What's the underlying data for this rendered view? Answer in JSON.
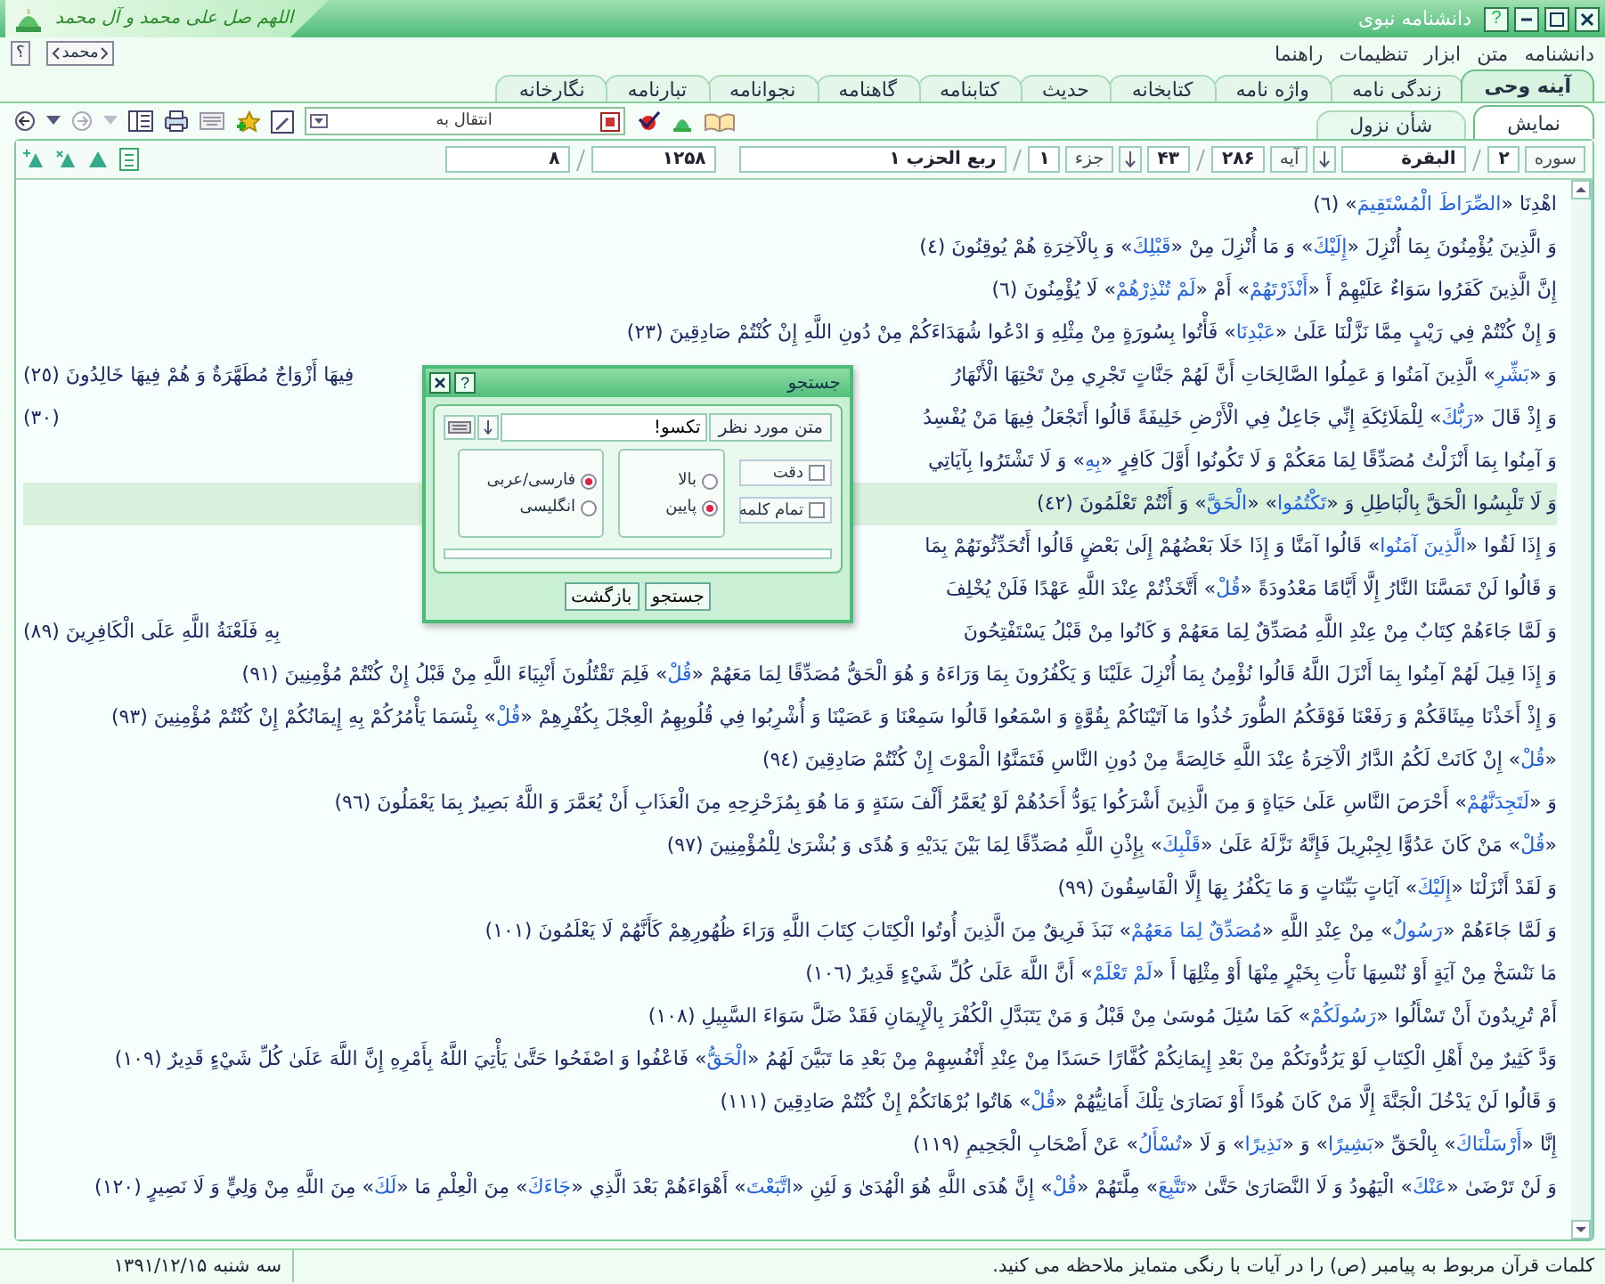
{
  "window": {
    "title": "دانشنامه نبوی",
    "banner": "اللهم صل علی محمد و آل محمد",
    "help_glyph": "?"
  },
  "menu": {
    "items": [
      "دانشنامه",
      "متن",
      "ابزار",
      "تنظیمات",
      "راهنما"
    ],
    "help_button": "؟",
    "name_button": "محمد"
  },
  "tabs": [
    {
      "label": "آینه وحی",
      "selected": true
    },
    {
      "label": "زندگی نامه",
      "selected": false
    },
    {
      "label": "واژه نامه",
      "selected": false
    },
    {
      "label": "کتابخانه",
      "selected": false
    },
    {
      "label": "حدیث",
      "selected": false
    },
    {
      "label": "کتابنامه",
      "selected": false
    },
    {
      "label": "گاهنامه",
      "selected": false
    },
    {
      "label": "نجوانامه",
      "selected": false
    },
    {
      "label": "تبارنامه",
      "selected": false
    },
    {
      "label": "نگارخانه",
      "selected": false
    }
  ],
  "toolbar": {
    "goto_select": "انتقال به"
  },
  "subtabs": [
    {
      "label": "نمایش",
      "selected": true
    },
    {
      "label": "شأن نزول",
      "selected": false
    }
  ],
  "navigation": {
    "sura_label": "سوره",
    "sura_number": "۲",
    "sura_name": "البقرة",
    "aya_label": "آیه",
    "aya_total": "۲۸۶",
    "aya_number": "۴۳",
    "juz_label": "جزء",
    "juz_number": "۱",
    "hizb": "ربع الحزب ۱",
    "page_total": "۱۲۵۸",
    "page": "۸"
  },
  "verses": [
    {
      "text": "اهْدِنَا «**الصِّرَاطَ الْمُسْتَقِيمَ**» (٦)",
      "selected": false
    },
    {
      "text": "وَ الَّذِينَ يُؤْمِنُونَ بِمَا أُنْزِلَ «**إِلَيْكَ**» وَ مَا أُنْزِلَ مِنْ «**قَبْلِكَ**» وَ بِالْآخِرَةِ هُمْ يُوقِنُونَ (٤)",
      "selected": false
    },
    {
      "text": "إِنَّ الَّذِينَ كَفَرُوا سَوَاءٌ عَلَيْهِمْ أَ «**أَنْذَرْتَهُمْ**» أَمْ «**لَمْ تُنْذِرْهُمْ**» لَا يُؤْمِنُونَ (٦)",
      "selected": false
    },
    {
      "text": "وَ إِنْ كُنْتُمْ فِي رَيْبٍ مِمَّا نَزَّلْنَا عَلَىٰ «**عَبْدِنَا**» فَأْتُوا بِسُورَةٍ مِنْ مِثْلِهِ وَ ادْعُوا شُهَدَاءَكُمْ مِنْ دُونِ اللَّهِ إِنْ كُنْتُمْ صَادِقِينَ (٢٣)",
      "selected": false
    },
    {
      "text": "وَ «**بَشِّرِ**» الَّذِينَ آمَنُوا وَ عَمِلُوا الصَّالِحَاتِ أَنَّ لَهُمْ جَنَّاتٍ تَجْرِي مِنْ تَحْتِهَا الْأَنْهَارُ",
      "left": "فِيهَا أَزْوَاجٌ مُطَهَّرَةٌ وَ هُمْ فِيهَا خَالِدُونَ (٢٥)",
      "selected": false
    },
    {
      "text": "وَ إِذْ قَالَ «**رَبُّكَ**» لِلْمَلَائِكَةِ إِنِّي جَاعِلٌ فِي الْأَرْضِ خَلِيفَةً قَالُوا أَتَجْعَلُ فِيهَا مَنْ يُفْسِدُ",
      "left": "(٣٠)",
      "selected": false
    },
    {
      "text": "وَ آمِنُوا بِمَا أَنْزَلْتُ مُصَدِّقًا لِمَا مَعَكُمْ وَ لَا تَكُونُوا أَوَّلَ كَافِرٍ «**بِهِ**» وَ لَا تَشْتَرُوا بِآيَاتِي",
      "selected": false
    },
    {
      "text": "وَ لَا تَلْبِسُوا الْحَقَّ بِالْبَاطِلِ وَ «**تَكْتُمُوا**» «**الْحَقَّ**» وَ أَنْتُمْ تَعْلَمُونَ (٤٢)",
      "selected": true
    },
    {
      "text": "وَ إِذَا لَقُوا «**الَّذِينَ آمَنُوا**» قَالُوا آمَنَّا وَ إِذَا خَلَا بَعْضُهُمْ إِلَىٰ بَعْضٍ قَالُوا أَتُحَدِّثُونَهُمْ بِمَا",
      "selected": false
    },
    {
      "text": "وَ قَالُوا لَنْ تَمَسَّنَا النَّارُ إِلَّا أَيَّامًا مَعْدُودَةً «**قُلْ**» أَتَّخَذْتُمْ عِنْدَ اللَّهِ عَهْدًا فَلَنْ يُخْلِفَ",
      "selected": false
    },
    {
      "text": "وَ لَمَّا جَاءَهُمْ كِتَابٌ مِنْ عِنْدِ اللَّهِ مُصَدِّقٌ لِمَا مَعَهُمْ وَ كَانُوا مِنْ قَبْلُ يَسْتَفْتِحُونَ",
      "left": "بِهِ فَلَعْنَةُ اللَّهِ عَلَى الْكَافِرِينَ (٨٩)",
      "selected": false
    },
    {
      "text": "وَ إِذَا قِيلَ لَهُمْ آمِنُوا بِمَا أَنْزَلَ اللَّهُ قَالُوا نُؤْمِنُ بِمَا أُنْزِلَ عَلَيْنَا وَ يَكْفُرُونَ بِمَا وَرَاءَهُ وَ هُوَ الْحَقُّ مُصَدِّقًا لِمَا مَعَهُمْ «**قُلْ**» فَلِمَ تَقْتُلُونَ أَنْبِيَاءَ اللَّهِ مِنْ قَبْلُ إِنْ كُنْتُمْ مُؤْمِنِينَ (٩١)",
      "selected": false
    },
    {
      "text": "وَ إِذْ أَخَذْنَا مِيثَاقَكُمْ وَ رَفَعْنَا فَوْقَكُمُ الطُّورَ خُذُوا مَا آتَيْنَاكُمْ بِقُوَّةٍ وَ اسْمَعُوا قَالُوا سَمِعْنَا وَ عَصَيْنَا وَ أُشْرِبُوا فِي قُلُوبِهِمُ الْعِجْلَ بِكُفْرِهِمْ «**قُلْ**» بِئْسَمَا يَأْمُرُكُمْ بِهِ إِيمَانُكُمْ إِنْ كُنْتُمْ مُؤْمِنِينَ (٩٣)",
      "selected": false
    },
    {
      "text": "«**قُلْ**» إِنْ كَانَتْ لَكُمُ الدَّارُ الْآخِرَةُ عِنْدَ اللَّهِ خَالِصَةً مِنْ دُونِ النَّاسِ فَتَمَنَّوُا الْمَوْتَ إِنْ كُنْتُمْ صَادِقِينَ (٩٤)",
      "selected": false
    },
    {
      "text": "وَ «**لَتَجِدَنَّهُمْ**» أَحْرَصَ النَّاسِ عَلَىٰ حَيَاةٍ وَ مِنَ الَّذِينَ أَشْرَكُوا يَوَدُّ أَحَدُهُمْ لَوْ يُعَمَّرُ أَلْفَ سَنَةٍ وَ مَا هُوَ بِمُزَحْزِحِهِ مِنَ الْعَذَابِ أَنْ يُعَمَّرَ وَ اللَّهُ بَصِيرٌ بِمَا يَعْمَلُونَ (٩٦)",
      "selected": false
    },
    {
      "text": "«**قُلْ**» مَنْ كَانَ عَدُوًّا لِجِبْرِيلَ فَإِنَّهُ نَزَّلَهُ عَلَىٰ «**قَلْبِكَ**» بِإِذْنِ اللَّهِ مُصَدِّقًا لِمَا بَيْنَ يَدَيْهِ وَ هُدًى وَ بُشْرَىٰ لِلْمُؤْمِنِينَ (٩٧)",
      "selected": false
    },
    {
      "text": "وَ لَقَدْ أَنْزَلْنَا «**إِلَيْكَ**» آيَاتٍ بَيِّنَاتٍ وَ مَا يَكْفُرُ بِهَا إِلَّا الْفَاسِقُونَ (٩٩)",
      "selected": false
    },
    {
      "text": "وَ لَمَّا جَاءَهُمْ «**رَسُولٌ**» مِنْ عِنْدِ اللَّهِ «**مُصَدِّقٌ لِمَا مَعَهُمْ**» نَبَذَ فَرِيقٌ مِنَ الَّذِينَ أُوتُوا الْكِتَابَ كِتَابَ اللَّهِ وَرَاءَ ظُهُورِهِمْ كَأَنَّهُمْ لَا يَعْلَمُونَ (١٠١)",
      "selected": false
    },
    {
      "text": "مَا نَنْسَخْ مِنْ آيَةٍ أَوْ نُنْسِهَا نَأْتِ بِخَيْرٍ مِنْهَا أَوْ مِثْلِهَا أَ «**لَمْ تَعْلَمْ**» أَنَّ اللَّهَ عَلَىٰ كُلِّ شَيْءٍ قَدِيرٌ (١٠٦)",
      "selected": false
    },
    {
      "text": "أَمْ تُرِيدُونَ أَنْ تَسْأَلُوا «**رَسُولَكُمْ**» كَمَا سُئِلَ مُوسَىٰ مِنْ قَبْلُ وَ مَنْ يَتَبَدَّلِ الْكُفْرَ بِالْإِيمَانِ فَقَدْ ضَلَّ سَوَاءَ السَّبِيلِ (١٠٨)",
      "selected": false
    },
    {
      "text": "وَدَّ كَثِيرٌ مِنْ أَهْلِ الْكِتَابِ لَوْ يَرُدُّونَكُمْ مِنْ بَعْدِ إِيمَانِكُمْ كُفَّارًا حَسَدًا مِنْ عِنْدِ أَنْفُسِهِمْ مِنْ بَعْدِ مَا تَبَيَّنَ لَهُمُ «**الْحَقُّ**» فَاعْفُوا وَ اصْفَحُوا حَتَّىٰ يَأْتِيَ اللَّهُ بِأَمْرِهِ إِنَّ اللَّهَ عَلَىٰ كُلِّ شَيْءٍ قَدِيرٌ (١٠٩)",
      "selected": false
    },
    {
      "text": "وَ قَالُوا لَنْ يَدْخُلَ الْجَنَّةَ إِلَّا مَنْ كَانَ هُودًا أَوْ نَصَارَىٰ تِلْكَ أَمَانِيُّهُمْ «**قُلْ**» هَاتُوا بُرْهَانَكُمْ إِنْ كُنْتُمْ صَادِقِينَ (١١١)",
      "selected": false
    },
    {
      "text": "إِنَّا «**أَرْسَلْنَاكَ**» بِالْحَقِّ «**بَشِيرًا**» وَ «**نَذِيرًا**» وَ لَا «**تُسْأَلُ**» عَنْ أَصْحَابِ الْجَحِيمِ (١١٩)",
      "selected": false
    },
    {
      "text": "وَ لَنْ تَرْضَىٰ «**عَنْكَ**» الْيَهُودُ وَ لَا النَّصَارَىٰ حَتَّىٰ «**تَتَّبِعَ**» مِلَّتَهُمْ «**قُلْ**» إِنَّ هُدَى اللَّهِ هُوَ الْهُدَىٰ وَ لَئِنِ «**اتَّبَعْتَ**» أَهْوَاءَهُمْ بَعْدَ الَّذِي «**جَاءَكَ**» مِنَ الْعِلْمِ مَا «**لَكَ**» مِنَ اللَّهِ مِنْ وَلِيٍّ وَ لَا نَصِيرٍ (١٢٠)",
      "selected": false
    }
  ],
  "search_dialog": {
    "title": "جستجو",
    "help_glyph": "?",
    "field_label": "متن مورد نظر",
    "value": "تکسو!",
    "options": [
      {
        "label": "دقت",
        "checked": false
      },
      {
        "label": "تمام کلمه",
        "checked": false
      }
    ],
    "direction": [
      {
        "label": "بالا",
        "selected": false
      },
      {
        "label": "پایین",
        "selected": true
      }
    ],
    "language": [
      {
        "label": "فارسی/عربی",
        "selected": true
      },
      {
        "label": "انگلیسی",
        "selected": false
      }
    ],
    "progress": {
      "level": 0
    },
    "buttons": [
      "جستجو",
      "بازگشت"
    ]
  },
  "status_bar": {
    "message": "کلمات قرآن مربوط به پیامبر (ص) را در آیات با رنگی متمایز ملاحظه می کنید.",
    "date": "سه شنبه ۱۳۹۱/۱۲/۱۵"
  }
}
